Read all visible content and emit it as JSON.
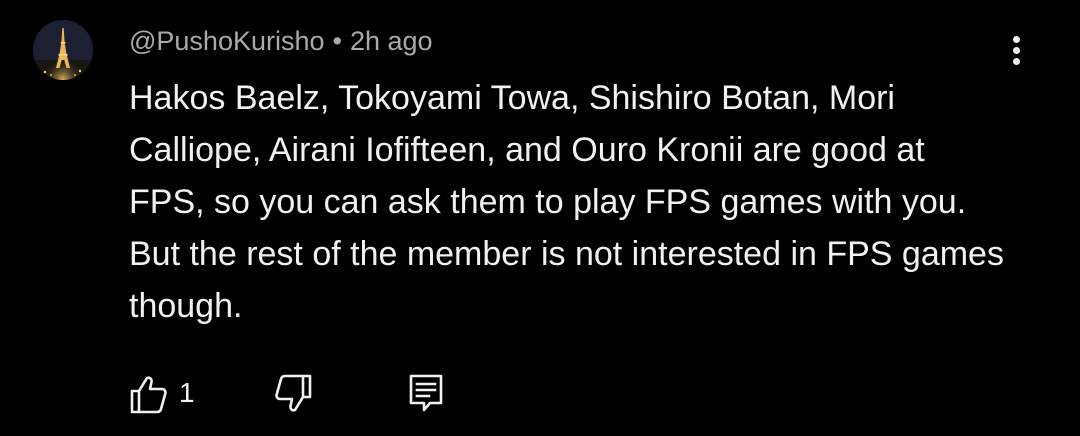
{
  "comment": {
    "author": "@PushoKurisho",
    "separator": "•",
    "timestamp": "2h ago",
    "text": "Hakos Baelz, Tokoyami Towa, Shishiro Botan, Mori Calliope, Airani Iofifteen, and Ouro Kronii are good at FPS, so you can ask them to play FPS games with you. But the rest of the member is not interested in FPS games though.",
    "like_count": "1"
  },
  "icons": {
    "avatar": "eiffel-tower-night-photo",
    "more": "vertical-ellipsis-icon",
    "like": "thumbs-up-icon",
    "dislike": "thumbs-down-icon",
    "reply": "comment-reply-icon"
  },
  "colors": {
    "background": "#000000",
    "primary_text": "#f1f1f1",
    "secondary_text": "#aaaaaa"
  }
}
